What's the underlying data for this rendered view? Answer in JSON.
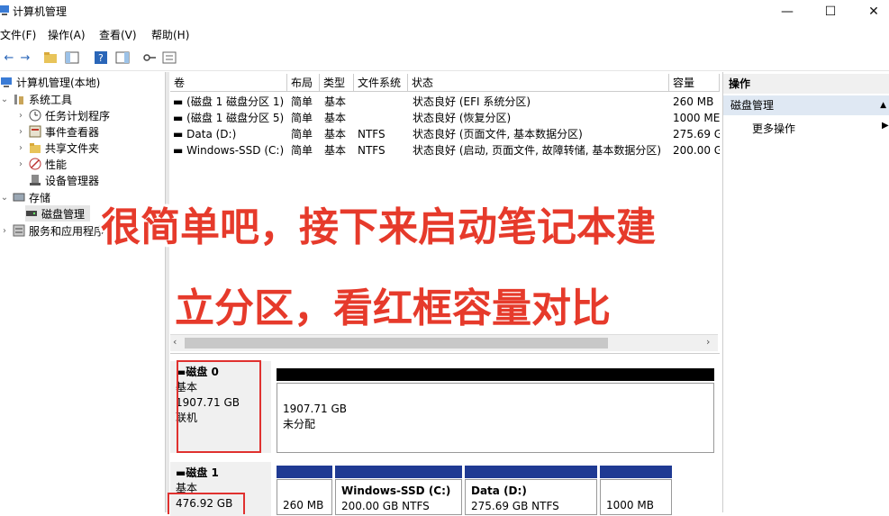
{
  "window": {
    "title": "计算机管理",
    "minimize": "—",
    "maximize": "☐",
    "close": "✕"
  },
  "menu": [
    "文件(F)",
    "操作(A)",
    "查看(V)",
    "帮助(H)"
  ],
  "toolbar": {
    "back": "←",
    "forward": "→"
  },
  "tree": {
    "root": "计算机管理(本地)",
    "system_tools": "系统工具",
    "task_scheduler": "任务计划程序",
    "event_viewer": "事件查看器",
    "shared_folders": "共享文件夹",
    "performance": "性能",
    "device_manager": "设备管理器",
    "storage": "存储",
    "disk_management": "磁盘管理",
    "services_apps": "服务和应用程序"
  },
  "volume_table": {
    "columns": [
      "卷",
      "布局",
      "类型",
      "文件系统",
      "状态",
      "容量"
    ],
    "rows": [
      [
        "(磁盘 1 磁盘分区 1)",
        "简单",
        "基本",
        "",
        "状态良好 (EFI 系统分区)",
        "260 MB"
      ],
      [
        "(磁盘 1 磁盘分区 5)",
        "简单",
        "基本",
        "",
        "状态良好 (恢复分区)",
        "1000 ME"
      ],
      [
        "Data (D:)",
        "简单",
        "基本",
        "NTFS",
        "状态良好 (页面文件, 基本数据分区)",
        "275.69 G"
      ],
      [
        "Windows-SSD (C:)",
        "简单",
        "基本",
        "NTFS",
        "状态良好 (启动, 页面文件, 故障转储, 基本数据分区)",
        "200.00 G"
      ]
    ]
  },
  "disks": {
    "disk0": {
      "name": "磁盘 0",
      "type": "基本",
      "size": "1907.71 GB",
      "status": "联机",
      "partition": {
        "size": "1907.71 GB",
        "label": "未分配"
      }
    },
    "disk1": {
      "name": "磁盘 1",
      "type": "基本",
      "size": "476.92 GB",
      "partitions": [
        {
          "name": "",
          "size": "260 MB"
        },
        {
          "name": "Windows-SSD  (C:)",
          "size": "200.00 GB NTFS"
        },
        {
          "name": "Data  (D:)",
          "size": "275.69 GB NTFS"
        },
        {
          "name": "",
          "size": "1000 MB"
        }
      ]
    }
  },
  "actions": {
    "header": "操作",
    "section": "磁盘管理",
    "more": "更多操作"
  },
  "overlay": {
    "line1": "很简单吧，接下来启动笔记本建",
    "line2": "立分区，看红框容量对比"
  },
  "colors": {
    "unallocated": "#000000",
    "primary": "#1f3a93",
    "highlight_box": "#e0312f",
    "overlay_text": "#e63a2b"
  }
}
